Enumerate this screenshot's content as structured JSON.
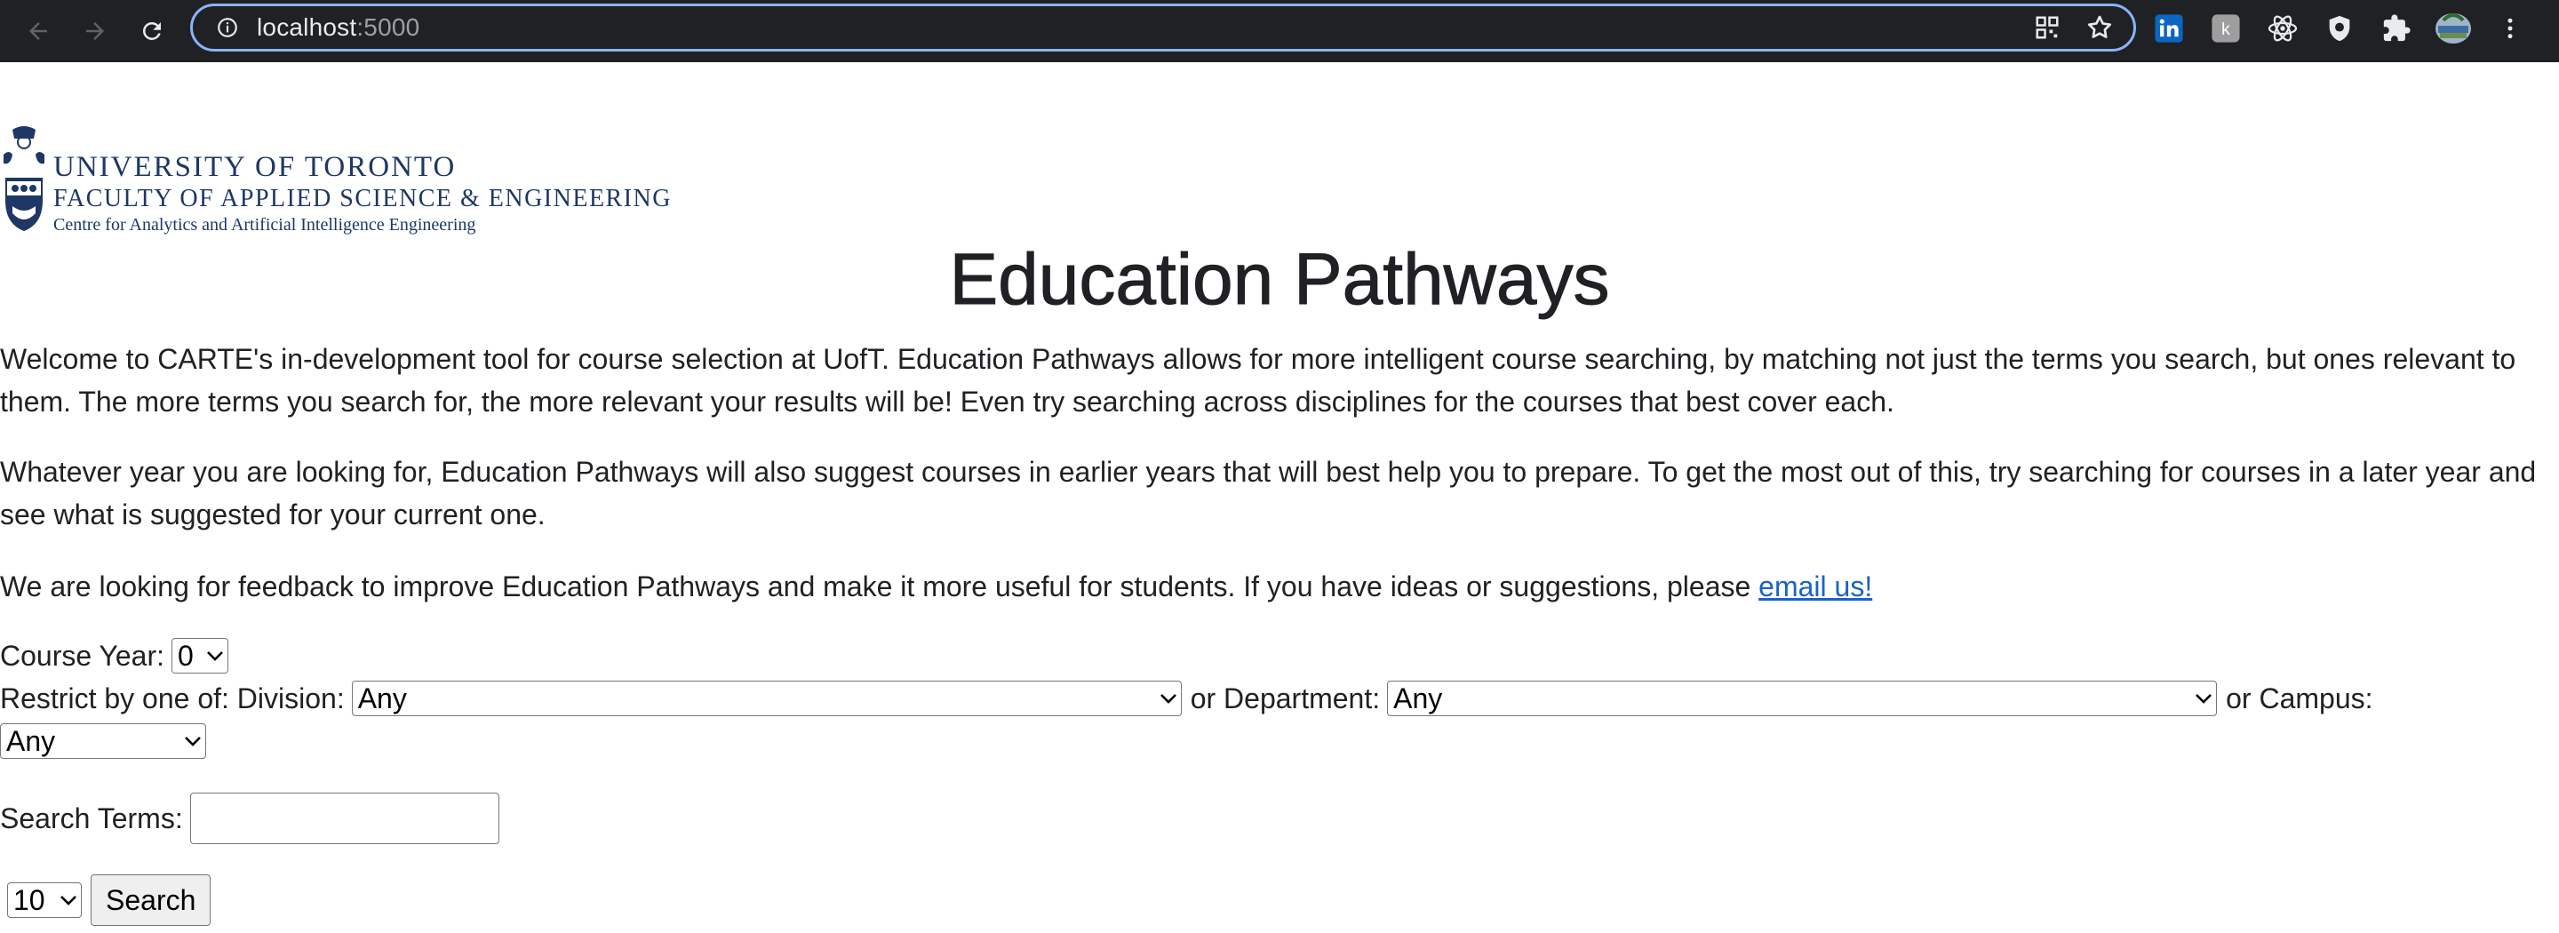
{
  "browser": {
    "url_host": "localhost",
    "url_port": ":5000"
  },
  "logo": {
    "line1": "UNIVERSITY OF TORONTO",
    "line2": "FACULTY OF APPLIED SCIENCE & ENGINEERING",
    "line3": "Centre for Analytics and Artificial Intelligence Engineering"
  },
  "page": {
    "title": "Education Pathways",
    "para1": "Welcome to CARTE's in-development tool for course selection at UofT. Education Pathways allows for more intelligent course searching, by matching not just the terms you search, but ones relevant to them. The more terms you search for, the more relevant your results will be! Even try searching across disciplines for the courses that best cover each.",
    "para2": "Whatever year you are looking for, Education Pathways will also suggest courses in earlier years that will best help you to prepare. To get the most out of this, try searching for courses in a later year and see what is suggested for your current one.",
    "para3_text": "We are looking for feedback to improve Education Pathways and make it more useful for students. If you have ideas or suggestions, please ",
    "para3_link": "email us!"
  },
  "form": {
    "course_year_label": "Course Year:",
    "course_year_value": "0",
    "restrict_label": "Restrict by one of: Division:",
    "division_value": "Any",
    "or_department_label": "or Department:",
    "department_value": "Any",
    "or_campus_label": "or Campus:",
    "campus_value": "Any",
    "search_terms_label": "Search Terms:",
    "search_terms_value": "",
    "results_count_value": "10",
    "search_button": "Search"
  },
  "colors": {
    "chrome_bg": "#202124",
    "address_focus": "#8ab4f8",
    "link": "#1a62c9",
    "logo_navy": "#1e3765"
  }
}
